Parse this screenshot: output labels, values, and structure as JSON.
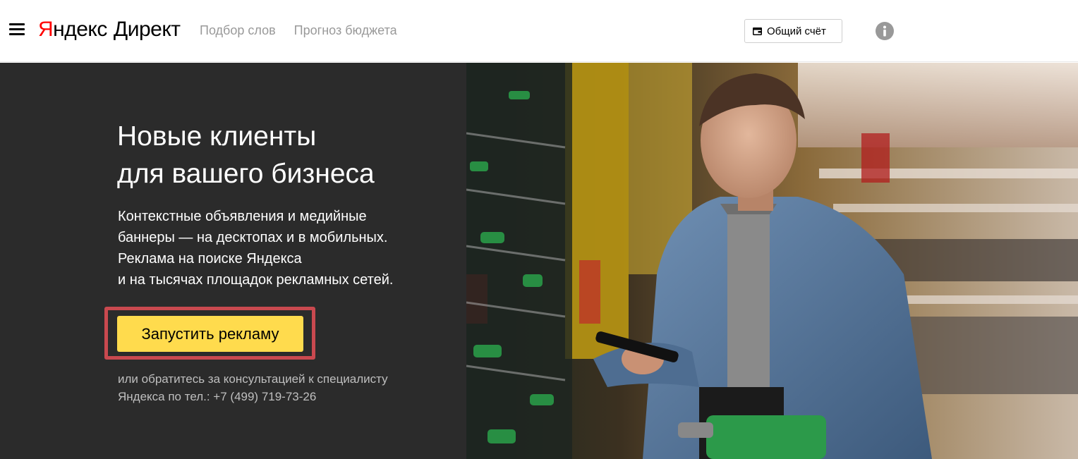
{
  "header": {
    "logo": {
      "brand_first": "Я",
      "brand_rest": "ндекс",
      "product": "Директ"
    },
    "nav": [
      {
        "label": "Подбор слов"
      },
      {
        "label": "Прогноз бюджета"
      }
    ],
    "account_button": {
      "label": "Общий счёт"
    }
  },
  "hero": {
    "headline": [
      "Новые клиенты",
      "для вашего бизнеса"
    ],
    "description": [
      "Контекстные объявления и медийные",
      "баннеры — на десктопах и в мобильных.",
      "Реклама на поиске Яндекса",
      "и на тысячах площадок рекламных сетей."
    ],
    "cta_label": "Запустить рекламу",
    "consult": [
      "или обратитесь за консультацией к специалисту",
      "Яндекса по тел.: +7 (499) 719-73-26"
    ]
  },
  "colors": {
    "brand_red": "#ff0000",
    "cta_yellow": "#ffdb4d",
    "hero_bg": "#2b2b2b",
    "highlight_frame": "#c9494f"
  },
  "icons": {
    "menu": "hamburger-menu-icon",
    "wallet": "wallet-icon",
    "info": "info-icon"
  }
}
